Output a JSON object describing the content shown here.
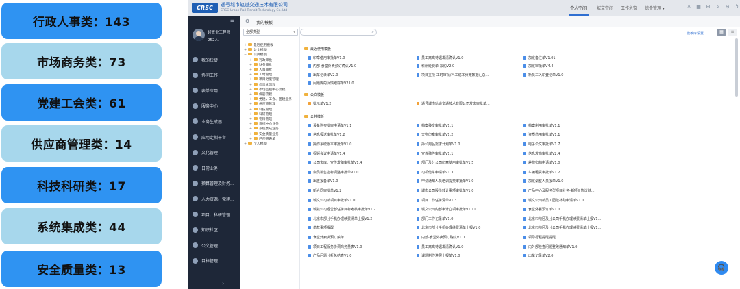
{
  "cards": [
    {
      "label": "行政人事类：143",
      "style": "blue"
    },
    {
      "label": "市场商务类：73",
      "style": "light"
    },
    {
      "label": "党建工会类：61",
      "style": "blue"
    },
    {
      "label": "供应商管理类：14",
      "style": "light"
    },
    {
      "label": "科技科研类：17",
      "style": "blue"
    },
    {
      "label": "系统集成类：44",
      "style": "light"
    },
    {
      "label": "安全质量类：13",
      "style": "blue"
    }
  ],
  "header": {
    "logo_text": "CRSC",
    "company_name": "通号城市轨道交通技术有限公司",
    "company_en": "CRSC Urban Rail Transit Technology Co.,Ltd",
    "nav": [
      "个人空间",
      "城文空间",
      "工作之窗",
      "综合管理 ▾"
    ],
    "active_nav": "个人空间"
  },
  "user": {
    "name": "超管化工程师",
    "count": "252人"
  },
  "sidebar_items": [
    "我的快捷",
    "协同工作",
    "表单应用",
    "服务中心",
    "业务生成器",
    "应用定制平台",
    "文化管理",
    "日常业务",
    "预算管理及财务...",
    "人力资源、党建...",
    "项目、科研管理...",
    "知识社区",
    "公文管理",
    "目标管理"
  ],
  "page_title": "我的模板",
  "category_select": "全部类型",
  "search": {
    "placeholder": ""
  },
  "template_settings": "模板库设置",
  "tree": [
    {
      "label": "最近使用模板",
      "level": 1,
      "toggle": "+"
    },
    {
      "label": "公文模板",
      "level": 1,
      "toggle": "+"
    },
    {
      "label": "公共模板",
      "level": 1,
      "toggle": "−"
    },
    {
      "label": "行政审批",
      "level": 2,
      "toggle": "+"
    },
    {
      "label": "财务审批",
      "level": 2,
      "toggle": "+"
    },
    {
      "label": "人事审批",
      "level": 2,
      "toggle": "+"
    },
    {
      "label": "工时管理",
      "level": 2,
      "toggle": "+"
    },
    {
      "label": "项目进度管理",
      "level": 2,
      "toggle": "+"
    },
    {
      "label": "信息化流程",
      "level": 2,
      "toggle": "+"
    },
    {
      "label": "市场监控中心流程",
      "level": 2,
      "toggle": "+"
    },
    {
      "label": "保密流程",
      "level": 2,
      "toggle": "+"
    },
    {
      "label": "党建、工会、团建业务",
      "level": 2,
      "toggle": "+"
    },
    {
      "label": "供应商管理",
      "level": 2,
      "toggle": "+"
    },
    {
      "label": "科技管理",
      "level": 2,
      "toggle": "+"
    },
    {
      "label": "科研管理",
      "level": 2,
      "toggle": "+"
    },
    {
      "label": "物料管理",
      "level": 2,
      "toggle": "+"
    },
    {
      "label": "系统中心业务",
      "level": 2,
      "toggle": "+"
    },
    {
      "label": "系统集成业务",
      "level": 2,
      "toggle": "+"
    },
    {
      "label": "安全质量业务",
      "level": 2,
      "toggle": "+"
    },
    {
      "label": "已停用表单",
      "level": 2,
      "toggle": "+"
    },
    {
      "label": "个人模板",
      "level": 1,
      "toggle": "+"
    }
  ],
  "sections": [
    {
      "title": "最近使用模板",
      "items": [
        "印章借用审批单V1.0",
        "员工离离待遇发清确认V1.0",
        "加班备注单V1.01",
        "内部-食堂外卖预订确认V1.0",
        "科研经费单-采购V2.0",
        "加班审批单V4.4",
        "出车记录单V2.0",
        "项目立项-工时审批/人工成本分摊数据汇总...",
        "新员工入职登记单V1.0",
        "问题库的反馈跟踪单V21.0"
      ]
    },
    {
      "title": "公文模板",
      "items": [
        "批示单V1.2",
        "通号城市轨道交通技术有限公司发文审批单..."
      ]
    },
    {
      "title": "公共模板",
      "items": [
        "设备购买批审申请单V1.1",
        "档案移交审批单V1.1",
        "档案利用审批单V1.1",
        "信息报送审批单V1.2",
        "文物印章审批单V1.2",
        "资质借用审批单V1.1",
        "操作系统版本审批单V1.0",
        "办公用品需求计划单V1.0",
        "电子公文审批单V1.7",
        "视频会议申请单V1.4",
        "宣传稿件审批单V1.1",
        "信息发布审批单V2.4",
        "公司文库、宣传发稿审批单V1.4",
        "部门及分公司印章使用审批单V1.5",
        "差旅归档申请单V1.0",
        "会员销售指标调整审批单V1.0",
        "司机借车申请单V1.3",
        "车辆租赁审批单V1.2",
        "出差报备单V1.0",
        "申请通知人员培训提交审批单V1.0",
        "加班调整人员报单V1.0",
        "新合同审批单V1.2",
        "城市公司股份转让事项审批单V1.0",
        "产品中心及服务型项目业务-新项目协议财...",
        "城文公司新项目审批单V1.0",
        "项目工作任务清单V1.3",
        "城文公司新员工团建补助申请单V1.0",
        "城轨公司经营部任务目标考核审批单V1.2",
        "城文公司内部审计立项审批单V1.11",
        "食堂外餐预订单V1.0",
        "北京市部分手机办理续费清单上报V1.2",
        "部门工作记录单V1.0",
        "北京市地区及分公司手机办理续费清单上报V1...",
        "借款事项提醒",
        "北京市部分手机办理续费清单上报V1.0",
        "北京市地区及分公司手机办理续费清单上报V1...",
        "食堂外卖类预订菜单",
        "内部-食堂外卖预订确认V1.0",
        "领导行程提醒提醒",
        "项目工程服务协调商务量表V1.0",
        "员工离离待遇发清确认V1.0",
        "内外部检查问题整改通知单V1.0",
        "产品问题分析总结表V1.0",
        "课题制作进展上报单V1.0",
        "出车记录单V2.0"
      ]
    }
  ]
}
